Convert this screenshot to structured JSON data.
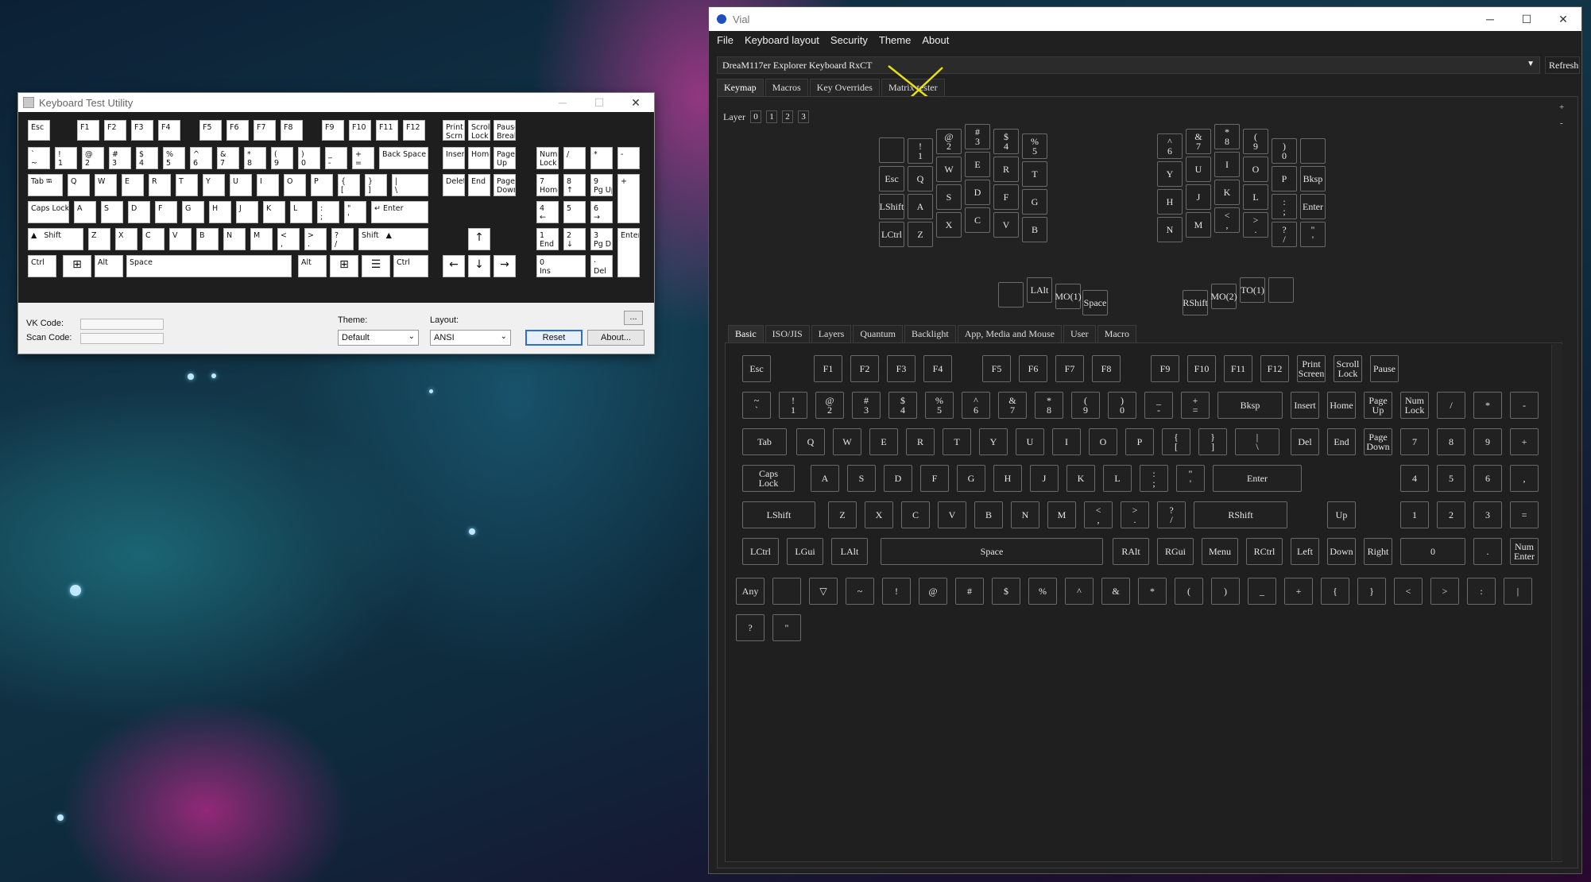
{
  "wallpaper": {
    "description_colors": [
      "#0c2035",
      "#12384a",
      "#ff3cb4",
      "#28a0aa"
    ]
  },
  "ktu": {
    "title": "Keyboard Test Utility",
    "controls": {
      "minimize": "─",
      "maximize": "☐",
      "close": "✕"
    },
    "keys": [
      "Esc",
      "F1",
      "F2",
      "F3",
      "F4",
      "F5",
      "F6",
      "F7",
      "F8",
      "F9",
      "F10",
      "F11",
      "F12",
      "Print\nScrn",
      "Scroll\nLock",
      "Pause\nBreak",
      "`\n~",
      "!\n1",
      "@\n2",
      "#\n3",
      "$\n4",
      "%\n5",
      "^\n6",
      "&\n7",
      "*\n8",
      "(\n9",
      ")\n0",
      "_\n-",
      "+\n=",
      "Back Space",
      "Insert",
      "Home",
      "Page\nUp",
      "Num\nLock",
      "/",
      "*",
      "-",
      "Tab ⭾",
      "Q",
      "W",
      "E",
      "R",
      "T",
      "Y",
      "U",
      "I",
      "O",
      "P",
      "{\n[",
      "}\n]",
      "|\n\\",
      "Delete",
      "End",
      "Page\nDown",
      "7\nHome",
      "8\n↑",
      "9\nPg Up",
      "+",
      "Caps Lock",
      "A",
      "S",
      "D",
      "F",
      "G",
      "H",
      "J",
      "K",
      "L",
      ":\n;",
      "\"\n'",
      "↵ Enter",
      "4\n←",
      "5",
      "6\n→",
      "▲   Shift",
      "Z",
      "X",
      "C",
      "V",
      "B",
      "N",
      "M",
      "<\n,",
      ">\n.",
      "?\n/",
      "Shift   ▲",
      "↑",
      "1\nEnd",
      "2\n↓",
      "3\nPg Dn",
      "Enter",
      "Ctrl",
      "⊞",
      "Alt",
      "Space",
      "Alt",
      "⊞",
      "☰",
      "Ctrl",
      "←",
      "↓",
      "→",
      "0\nIns",
      "·\nDel"
    ],
    "vk_code_label": "VK Code:",
    "scan_code_label": "Scan Code:",
    "theme_label": "Theme:",
    "theme_value": "Default",
    "layout_label": "Layout:",
    "layout_value": "ANSI",
    "ellipsis_btn": "...",
    "reset_btn": "Reset",
    "about_btn": "About..."
  },
  "vial": {
    "title": "Vial",
    "controls": {
      "minimize": "─",
      "maximize": "☐",
      "close": "✕"
    },
    "menu": [
      "File",
      "Keyboard layout",
      "Security",
      "Theme",
      "About"
    ],
    "device": "DreaM117er Explorer Keyboard RxCT",
    "refresh": "Refresh",
    "main_tabs": [
      "Keymap",
      "Macros",
      "Key Overrides",
      "Matrix tester"
    ],
    "layer_label": "Layer",
    "layers": [
      "0",
      "1",
      "2",
      "3"
    ],
    "zoom_plus": "+",
    "zoom_minus": "-",
    "split_keys": [
      "",
      "!\n1",
      "@\n2",
      "#\n3",
      "$\n4",
      "%\n5",
      "Esc",
      "Q",
      "W",
      "E",
      "R",
      "T",
      "LShift",
      "A",
      "S",
      "D",
      "F",
      "G",
      "LCtrl",
      "Z",
      "X",
      "C",
      "V",
      "B",
      "",
      "LAlt",
      "MO(1)",
      "Space",
      "^\n6",
      "&\n7",
      "*\n8",
      "(\n9",
      ")\n0",
      "",
      "Y",
      "U",
      "I",
      "O",
      "P",
      "Bksp",
      "H",
      "J",
      "K",
      "L",
      ":\n;",
      "Enter",
      "N",
      "M",
      "<\n,",
      ">\n.",
      "?\n/",
      "\"\n'",
      "RShift",
      "MO(2)",
      "TO(1)",
      ""
    ],
    "key_tabs": [
      "Basic",
      "ISO/JIS",
      "Layers",
      "Quantum",
      "Backlight",
      "App, Media and Mouse",
      "User",
      "Macro"
    ],
    "basic_rows": [
      [
        "Esc",
        "F1",
        "F2",
        "F3",
        "F4",
        "F5",
        "F6",
        "F7",
        "F8",
        "F9",
        "F10",
        "F11",
        "F12",
        "Print\nScreen",
        "Scroll\nLock",
        "Pause"
      ],
      [
        "~\n`",
        "!\n1",
        "@\n2",
        "#\n3",
        "$\n4",
        "%\n5",
        "^\n6",
        "&\n7",
        "*\n8",
        "(\n9",
        ")\n0",
        "_\n-",
        "+\n=",
        "Bksp",
        "Insert",
        "Home",
        "Page\nUp",
        "Num\nLock",
        "/",
        "*",
        "-"
      ],
      [
        "Tab",
        "Q",
        "W",
        "E",
        "R",
        "T",
        "Y",
        "U",
        "I",
        "O",
        "P",
        "{\n[",
        "}\n]",
        "|\n\\",
        "Del",
        "End",
        "Page\nDown",
        "7",
        "8",
        "9",
        "+"
      ],
      [
        "Caps\nLock",
        "A",
        "S",
        "D",
        "F",
        "G",
        "H",
        "J",
        "K",
        "L",
        ":\n;",
        "\"\n'",
        "Enter",
        "4",
        "5",
        "6",
        ","
      ],
      [
        "LShift",
        "Z",
        "X",
        "C",
        "V",
        "B",
        "N",
        "M",
        "<\n,",
        ">\n.",
        "?\n/",
        "RShift",
        "Up",
        "1",
        "2",
        "3",
        "="
      ],
      [
        "LCtrl",
        "LGui",
        "LAlt",
        "Space",
        "RAlt",
        "RGui",
        "Menu",
        "RCtrl",
        "Left",
        "Down",
        "Right",
        "0",
        ".",
        "Num\nEnter"
      ],
      [
        "Any",
        "",
        "▽",
        "~",
        "!",
        "@",
        "#",
        "$",
        "%",
        "^",
        "&",
        "*",
        "(",
        ")",
        "_",
        "+",
        "{",
        "}",
        "<",
        ">",
        ":",
        "|"
      ],
      [
        "?",
        "\""
      ]
    ]
  }
}
